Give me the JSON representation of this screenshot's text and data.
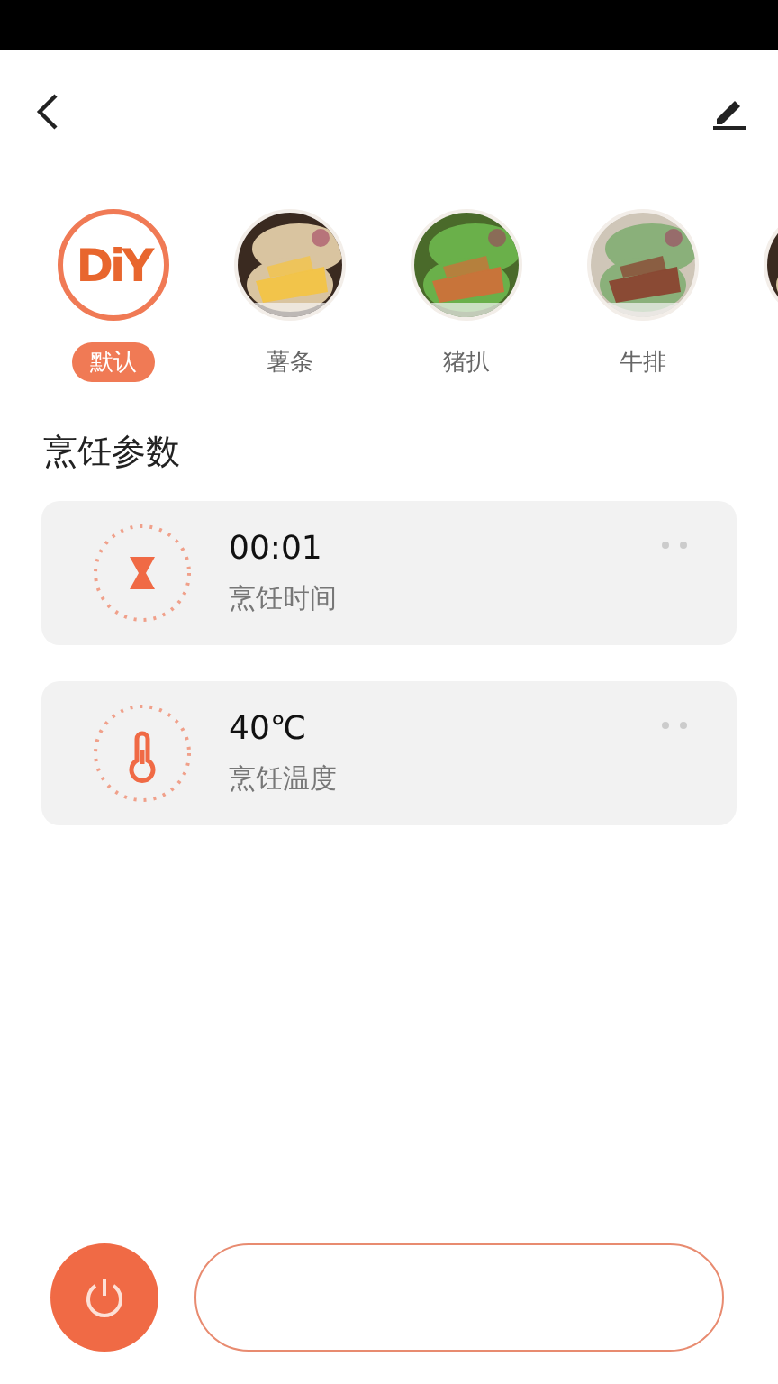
{
  "recipes": [
    {
      "kind": "logo",
      "logo_text": "DiY",
      "label": "默认",
      "selected": true
    },
    {
      "kind": "picture",
      "label": "薯条",
      "selected": false
    },
    {
      "kind": "picture",
      "label": "猪扒",
      "selected": false
    },
    {
      "kind": "picture",
      "label": "牛排",
      "selected": false
    },
    {
      "kind": "picture"
    }
  ],
  "section_title": "烹饪参数",
  "params": [
    {
      "kind": "time",
      "value": "00:01",
      "label": "烹饪时间"
    },
    {
      "kind": "temperature",
      "value": "40℃",
      "label": "烹饪温度"
    }
  ]
}
